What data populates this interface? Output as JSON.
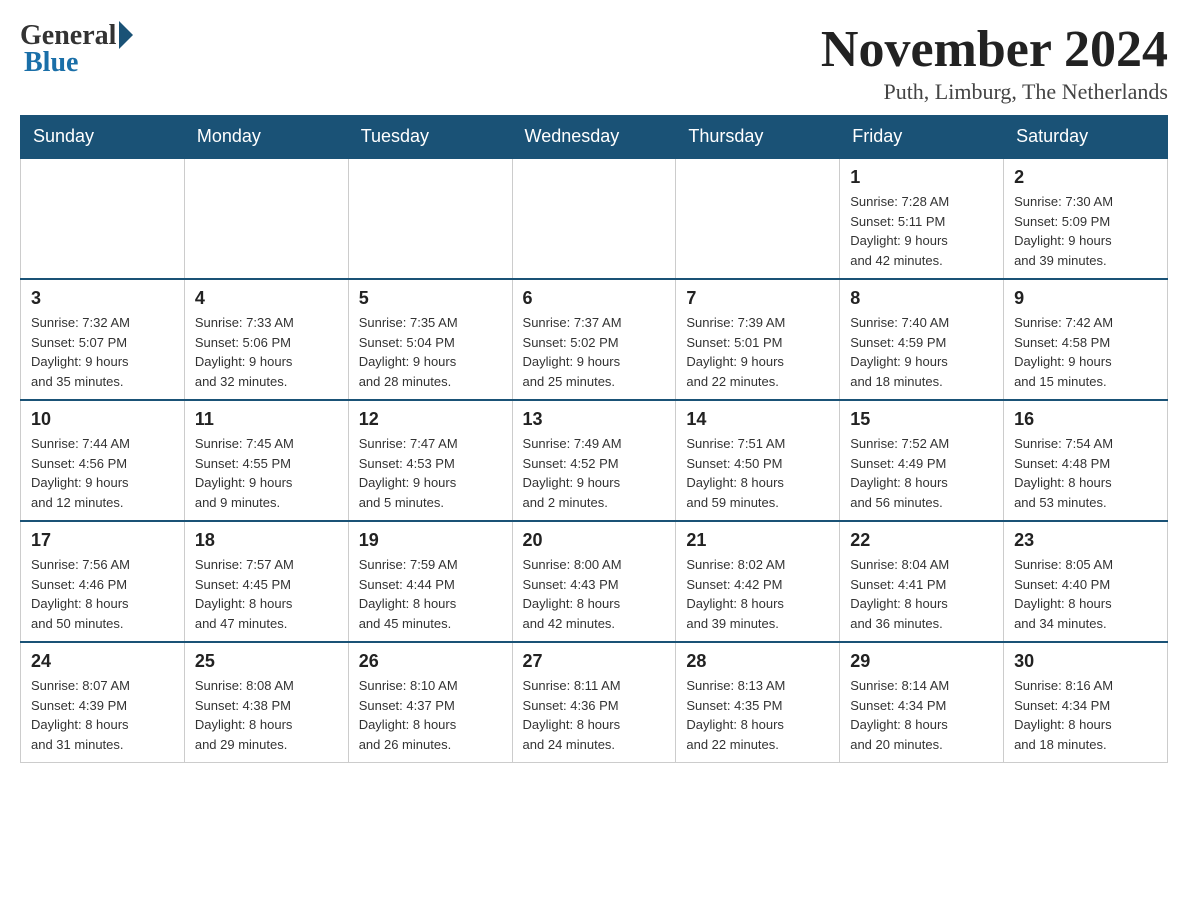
{
  "logo": {
    "general": "General",
    "blue": "Blue"
  },
  "title": "November 2024",
  "location": "Puth, Limburg, The Netherlands",
  "days_of_week": [
    "Sunday",
    "Monday",
    "Tuesday",
    "Wednesday",
    "Thursday",
    "Friday",
    "Saturday"
  ],
  "weeks": [
    [
      {
        "day": "",
        "info": ""
      },
      {
        "day": "",
        "info": ""
      },
      {
        "day": "",
        "info": ""
      },
      {
        "day": "",
        "info": ""
      },
      {
        "day": "",
        "info": ""
      },
      {
        "day": "1",
        "info": "Sunrise: 7:28 AM\nSunset: 5:11 PM\nDaylight: 9 hours\nand 42 minutes."
      },
      {
        "day": "2",
        "info": "Sunrise: 7:30 AM\nSunset: 5:09 PM\nDaylight: 9 hours\nand 39 minutes."
      }
    ],
    [
      {
        "day": "3",
        "info": "Sunrise: 7:32 AM\nSunset: 5:07 PM\nDaylight: 9 hours\nand 35 minutes."
      },
      {
        "day": "4",
        "info": "Sunrise: 7:33 AM\nSunset: 5:06 PM\nDaylight: 9 hours\nand 32 minutes."
      },
      {
        "day": "5",
        "info": "Sunrise: 7:35 AM\nSunset: 5:04 PM\nDaylight: 9 hours\nand 28 minutes."
      },
      {
        "day": "6",
        "info": "Sunrise: 7:37 AM\nSunset: 5:02 PM\nDaylight: 9 hours\nand 25 minutes."
      },
      {
        "day": "7",
        "info": "Sunrise: 7:39 AM\nSunset: 5:01 PM\nDaylight: 9 hours\nand 22 minutes."
      },
      {
        "day": "8",
        "info": "Sunrise: 7:40 AM\nSunset: 4:59 PM\nDaylight: 9 hours\nand 18 minutes."
      },
      {
        "day": "9",
        "info": "Sunrise: 7:42 AM\nSunset: 4:58 PM\nDaylight: 9 hours\nand 15 minutes."
      }
    ],
    [
      {
        "day": "10",
        "info": "Sunrise: 7:44 AM\nSunset: 4:56 PM\nDaylight: 9 hours\nand 12 minutes."
      },
      {
        "day": "11",
        "info": "Sunrise: 7:45 AM\nSunset: 4:55 PM\nDaylight: 9 hours\nand 9 minutes."
      },
      {
        "day": "12",
        "info": "Sunrise: 7:47 AM\nSunset: 4:53 PM\nDaylight: 9 hours\nand 5 minutes."
      },
      {
        "day": "13",
        "info": "Sunrise: 7:49 AM\nSunset: 4:52 PM\nDaylight: 9 hours\nand 2 minutes."
      },
      {
        "day": "14",
        "info": "Sunrise: 7:51 AM\nSunset: 4:50 PM\nDaylight: 8 hours\nand 59 minutes."
      },
      {
        "day": "15",
        "info": "Sunrise: 7:52 AM\nSunset: 4:49 PM\nDaylight: 8 hours\nand 56 minutes."
      },
      {
        "day": "16",
        "info": "Sunrise: 7:54 AM\nSunset: 4:48 PM\nDaylight: 8 hours\nand 53 minutes."
      }
    ],
    [
      {
        "day": "17",
        "info": "Sunrise: 7:56 AM\nSunset: 4:46 PM\nDaylight: 8 hours\nand 50 minutes."
      },
      {
        "day": "18",
        "info": "Sunrise: 7:57 AM\nSunset: 4:45 PM\nDaylight: 8 hours\nand 47 minutes."
      },
      {
        "day": "19",
        "info": "Sunrise: 7:59 AM\nSunset: 4:44 PM\nDaylight: 8 hours\nand 45 minutes."
      },
      {
        "day": "20",
        "info": "Sunrise: 8:00 AM\nSunset: 4:43 PM\nDaylight: 8 hours\nand 42 minutes."
      },
      {
        "day": "21",
        "info": "Sunrise: 8:02 AM\nSunset: 4:42 PM\nDaylight: 8 hours\nand 39 minutes."
      },
      {
        "day": "22",
        "info": "Sunrise: 8:04 AM\nSunset: 4:41 PM\nDaylight: 8 hours\nand 36 minutes."
      },
      {
        "day": "23",
        "info": "Sunrise: 8:05 AM\nSunset: 4:40 PM\nDaylight: 8 hours\nand 34 minutes."
      }
    ],
    [
      {
        "day": "24",
        "info": "Sunrise: 8:07 AM\nSunset: 4:39 PM\nDaylight: 8 hours\nand 31 minutes."
      },
      {
        "day": "25",
        "info": "Sunrise: 8:08 AM\nSunset: 4:38 PM\nDaylight: 8 hours\nand 29 minutes."
      },
      {
        "day": "26",
        "info": "Sunrise: 8:10 AM\nSunset: 4:37 PM\nDaylight: 8 hours\nand 26 minutes."
      },
      {
        "day": "27",
        "info": "Sunrise: 8:11 AM\nSunset: 4:36 PM\nDaylight: 8 hours\nand 24 minutes."
      },
      {
        "day": "28",
        "info": "Sunrise: 8:13 AM\nSunset: 4:35 PM\nDaylight: 8 hours\nand 22 minutes."
      },
      {
        "day": "29",
        "info": "Sunrise: 8:14 AM\nSunset: 4:34 PM\nDaylight: 8 hours\nand 20 minutes."
      },
      {
        "day": "30",
        "info": "Sunrise: 8:16 AM\nSunset: 4:34 PM\nDaylight: 8 hours\nand 18 minutes."
      }
    ]
  ]
}
